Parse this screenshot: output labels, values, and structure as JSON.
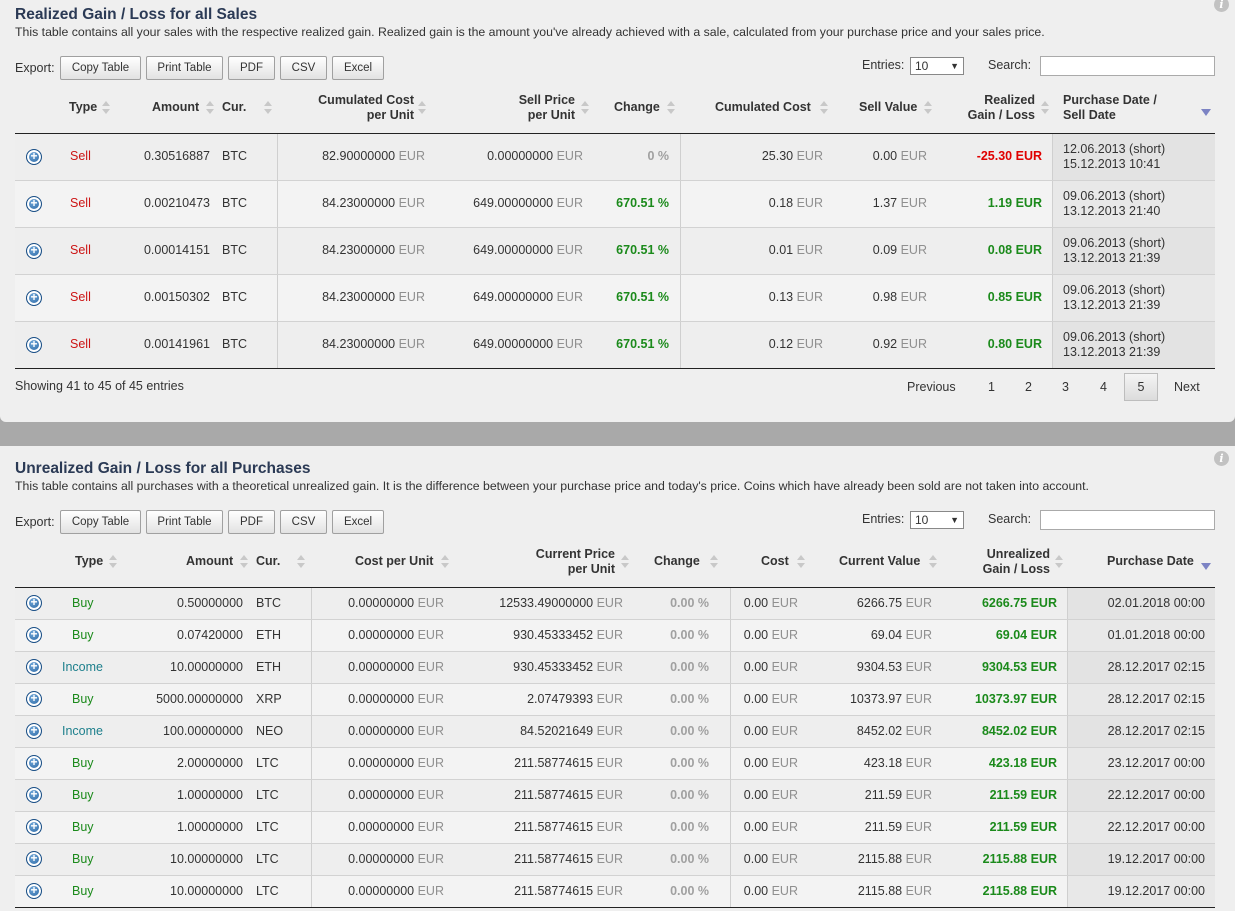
{
  "realized": {
    "title": "Realized Gain / Loss for all Sales",
    "description": "This table contains all your sales with the respective realized gain. Realized gain is the amount you've already achieved with a sale, calculated from your purchase price and your sales price.",
    "export_label": "Export:",
    "buttons": [
      "Copy Table",
      "Print Table",
      "PDF",
      "CSV",
      "Excel"
    ],
    "entries_label": "Entries:",
    "entries_value": "10",
    "search_label": "Search:",
    "headers": {
      "type": "Type",
      "amount": "Amount",
      "cur": "Cur.",
      "cum_cost_unit_1": "Cumulated Cost",
      "cum_cost_unit_2": "per Unit",
      "sell_price_1": "Sell Price",
      "sell_price_2": "per Unit",
      "change": "Change",
      "cum_cost": "Cumulated Cost",
      "sell_value": "Sell Value",
      "realized_1": "Realized",
      "realized_2": "Gain / Loss",
      "date_1": "Purchase Date /",
      "date_2": "Sell Date"
    },
    "currency": "EUR",
    "rows": [
      {
        "type": "Sell",
        "amount": "0.30516887",
        "cur": "BTC",
        "cum_cost_unit": "82.90000000",
        "sell_price": "0.00000000",
        "change": "0 %",
        "cum_cost": "25.30",
        "sell_value": "0.00",
        "gain": "-25.30 EUR",
        "date1": "12.06.2013 (short)",
        "date2": "15.12.2013 10:41"
      },
      {
        "type": "Sell",
        "amount": "0.00210473",
        "cur": "BTC",
        "cum_cost_unit": "84.23000000",
        "sell_price": "649.00000000",
        "change": "670.51 %",
        "cum_cost": "0.18",
        "sell_value": "1.37",
        "gain": "1.19 EUR",
        "date1": "09.06.2013 (short)",
        "date2": "13.12.2013 21:40"
      },
      {
        "type": "Sell",
        "amount": "0.00014151",
        "cur": "BTC",
        "cum_cost_unit": "84.23000000",
        "sell_price": "649.00000000",
        "change": "670.51 %",
        "cum_cost": "0.01",
        "sell_value": "0.09",
        "gain": "0.08 EUR",
        "date1": "09.06.2013 (short)",
        "date2": "13.12.2013 21:39"
      },
      {
        "type": "Sell",
        "amount": "0.00150302",
        "cur": "BTC",
        "cum_cost_unit": "84.23000000",
        "sell_price": "649.00000000",
        "change": "670.51 %",
        "cum_cost": "0.13",
        "sell_value": "0.98",
        "gain": "0.85 EUR",
        "date1": "09.06.2013 (short)",
        "date2": "13.12.2013 21:39"
      },
      {
        "type": "Sell",
        "amount": "0.00141961",
        "cur": "BTC",
        "cum_cost_unit": "84.23000000",
        "sell_price": "649.00000000",
        "change": "670.51 %",
        "cum_cost": "0.12",
        "sell_value": "0.92",
        "gain": "0.80 EUR",
        "date1": "09.06.2013 (short)",
        "date2": "13.12.2013 21:39"
      }
    ],
    "footer": "Showing 41 to 45 of 45 entries",
    "pagination": {
      "previous": "Previous",
      "pages": [
        "1",
        "2",
        "3",
        "4",
        "5"
      ],
      "active": "5",
      "next": "Next"
    }
  },
  "unrealized": {
    "title": "Unrealized Gain / Loss for all Purchases",
    "description": "This table contains all purchases with a theoretical unrealized gain. It is the difference between your purchase price and today's price. Coins which have already been sold are not taken into account.",
    "export_label": "Export:",
    "buttons": [
      "Copy Table",
      "Print Table",
      "PDF",
      "CSV",
      "Excel"
    ],
    "entries_label": "Entries:",
    "entries_value": "10",
    "search_label": "Search:",
    "headers": {
      "type": "Type",
      "amount": "Amount",
      "cur": "Cur.",
      "cost_unit": "Cost per Unit",
      "cur_price_1": "Current Price",
      "cur_price_2": "per Unit",
      "change": "Change",
      "cost": "Cost",
      "cur_value": "Current Value",
      "unreal_1": "Unrealized",
      "unreal_2": "Gain / Loss",
      "date": "Purchase Date"
    },
    "currency": "EUR",
    "rows": [
      {
        "type": "Buy",
        "amount": "0.50000000",
        "cur": "BTC",
        "cost_unit": "0.00000000",
        "cur_price": "12533.49000000",
        "change": "0.00 %",
        "cost": "0.00",
        "cur_value": "6266.75",
        "gain": "6266.75 EUR",
        "date": "02.01.2018 00:00"
      },
      {
        "type": "Buy",
        "amount": "0.07420000",
        "cur": "ETH",
        "cost_unit": "0.00000000",
        "cur_price": "930.45333452",
        "change": "0.00 %",
        "cost": "0.00",
        "cur_value": "69.04",
        "gain": "69.04 EUR",
        "date": "01.01.2018 00:00"
      },
      {
        "type": "Income",
        "amount": "10.00000000",
        "cur": "ETH",
        "cost_unit": "0.00000000",
        "cur_price": "930.45333452",
        "change": "0.00 %",
        "cost": "0.00",
        "cur_value": "9304.53",
        "gain": "9304.53 EUR",
        "date": "28.12.2017 02:15"
      },
      {
        "type": "Buy",
        "amount": "5000.00000000",
        "cur": "XRP",
        "cost_unit": "0.00000000",
        "cur_price": "2.07479393",
        "change": "0.00 %",
        "cost": "0.00",
        "cur_value": "10373.97",
        "gain": "10373.97 EUR",
        "date": "28.12.2017 02:15"
      },
      {
        "type": "Income",
        "amount": "100.00000000",
        "cur": "NEO",
        "cost_unit": "0.00000000",
        "cur_price": "84.52021649",
        "change": "0.00 %",
        "cost": "0.00",
        "cur_value": "8452.02",
        "gain": "8452.02 EUR",
        "date": "28.12.2017 02:15"
      },
      {
        "type": "Buy",
        "amount": "2.00000000",
        "cur": "LTC",
        "cost_unit": "0.00000000",
        "cur_price": "211.58774615",
        "change": "0.00 %",
        "cost": "0.00",
        "cur_value": "423.18",
        "gain": "423.18 EUR",
        "date": "23.12.2017 00:00"
      },
      {
        "type": "Buy",
        "amount": "1.00000000",
        "cur": "LTC",
        "cost_unit": "0.00000000",
        "cur_price": "211.58774615",
        "change": "0.00 %",
        "cost": "0.00",
        "cur_value": "211.59",
        "gain": "211.59 EUR",
        "date": "22.12.2017 00:00"
      },
      {
        "type": "Buy",
        "amount": "1.00000000",
        "cur": "LTC",
        "cost_unit": "0.00000000",
        "cur_price": "211.58774615",
        "change": "0.00 %",
        "cost": "0.00",
        "cur_value": "211.59",
        "gain": "211.59 EUR",
        "date": "22.12.2017 00:00"
      },
      {
        "type": "Buy",
        "amount": "10.00000000",
        "cur": "LTC",
        "cost_unit": "0.00000000",
        "cur_price": "211.58774615",
        "change": "0.00 %",
        "cost": "0.00",
        "cur_value": "2115.88",
        "gain": "2115.88 EUR",
        "date": "19.12.2017 00:00"
      },
      {
        "type": "Buy",
        "amount": "10.00000000",
        "cur": "LTC",
        "cost_unit": "0.00000000",
        "cur_price": "211.58774615",
        "change": "0.00 %",
        "cost": "0.00",
        "cur_value": "2115.88",
        "gain": "2115.88 EUR",
        "date": "19.12.2017 00:00"
      }
    ]
  }
}
